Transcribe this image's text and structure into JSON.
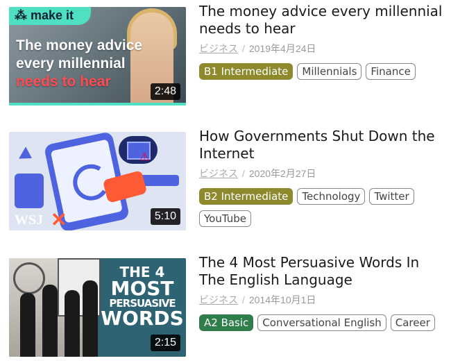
{
  "videos": [
    {
      "title": "The money advice every millennial needs to hear",
      "category": "ビジネス",
      "date": "2019年4月24日",
      "duration": "2:48",
      "level": "B1 Intermediate",
      "tags": [
        "Millennials",
        "Finance"
      ],
      "thumb": {
        "brand": "make it",
        "line1": "The money advice",
        "line2": "every millennial",
        "line3": "needs to hear"
      }
    },
    {
      "title": "How Governments Shut Down the Internet",
      "category": "ビジネス",
      "date": "2020年2月27日",
      "duration": "5:10",
      "level": "B2 Intermediate",
      "tags": [
        "Technology",
        "Twitter",
        "YouTube"
      ],
      "thumb": {
        "brand": "WSJ"
      }
    },
    {
      "title": "The 4 Most Persuasive Words In The English Language",
      "category": "ビジネス",
      "date": "2014年10月1日",
      "duration": "2:15",
      "level": "A2 Basic",
      "tags": [
        "Conversational English",
        "Career"
      ],
      "thumb": {
        "line1": "THE 4",
        "line2": "MOST",
        "line3": "PERSUASIVE",
        "line4": "WORDS"
      }
    }
  ],
  "separator": "/",
  "colors": {
    "b1": "#8c8a2c",
    "b2": "#8c8a2c",
    "a2": "#2f7d4a",
    "makeit_accent": "#4fe0c2"
  }
}
